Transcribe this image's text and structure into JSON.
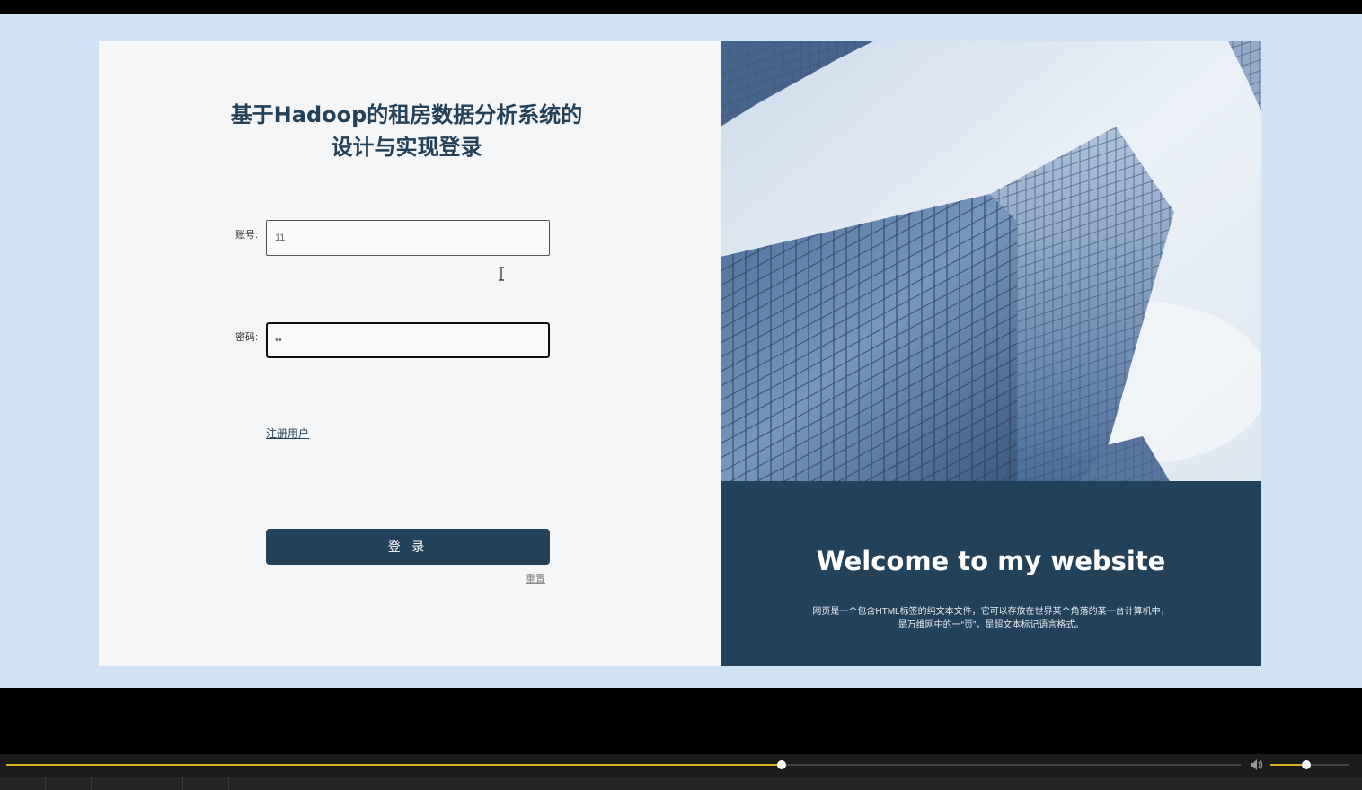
{
  "login": {
    "title": "基于Hadoop的租房数据分析系统的设计与实现登录",
    "account_label": "账号:",
    "account_value": "11",
    "password_label": "密码:",
    "password_value": "••",
    "register_link": "注册用户",
    "login_button": "登 录",
    "reset_link": "重置"
  },
  "welcome": {
    "title": "Welcome to my website",
    "description_line1": "网页是一个包含HTML标签的纯文本文件，它可以存放在世界某个角落的某一台计算机中，",
    "description_line2": "是万维网中的一“页”，是超文本标记语言格式。"
  },
  "player": {
    "progress_fraction": 0.628,
    "volume_fraction": 0.45
  },
  "colors": {
    "accent": "#24415a",
    "page_background": "#d0e3f5",
    "progress": "#e0b020"
  },
  "icons": {
    "text_cursor": "i-beam-cursor-icon",
    "volume": "speaker-icon"
  }
}
